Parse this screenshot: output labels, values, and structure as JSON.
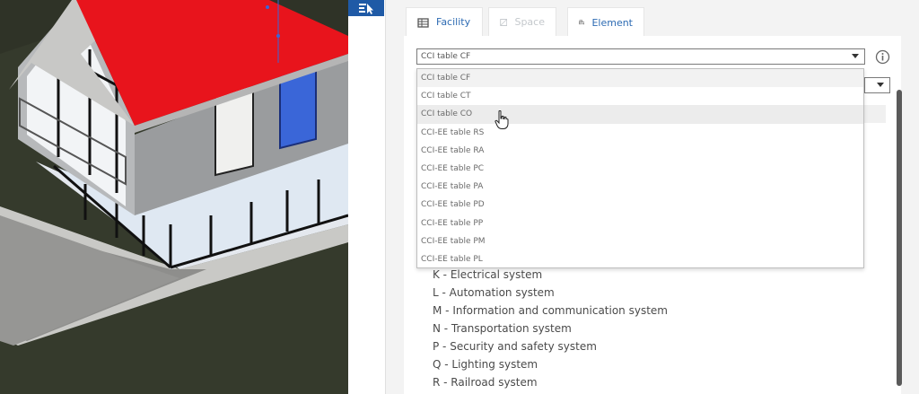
{
  "tabs": [
    {
      "label": "Facility",
      "icon": "building-icon",
      "state": "normal"
    },
    {
      "label": "Space",
      "icon": "space-icon",
      "state": "disabled"
    },
    {
      "label": "Element",
      "icon": "element-icon",
      "state": "active"
    }
  ],
  "classification_select": {
    "value": "CCI table CF"
  },
  "dropdown": {
    "options": [
      "CCI table CF",
      "CCI table CT",
      "CCI table CO",
      "CCI-EE table RS",
      "CCI-EE table RA",
      "CCI-EE table PC",
      "CCI-EE table PA",
      "CCI-EE table PD",
      "CCI-EE table PP",
      "CCI-EE table PM",
      "CCI-EE table PL"
    ],
    "selected": "CCI table CF",
    "hovered": "CCI table CO"
  },
  "systems": [
    "K - Electrical system",
    "L - Automation system",
    "M - Information and communication system",
    "N - Transportation system",
    "P - Security and safety system",
    "Q - Lighting system",
    "R - Railroad system"
  ],
  "colors": {
    "accent": "#2d6bb3",
    "tool_bg": "#1f5aa6",
    "roof": "#e8141c",
    "terrain": "#2f3327"
  }
}
